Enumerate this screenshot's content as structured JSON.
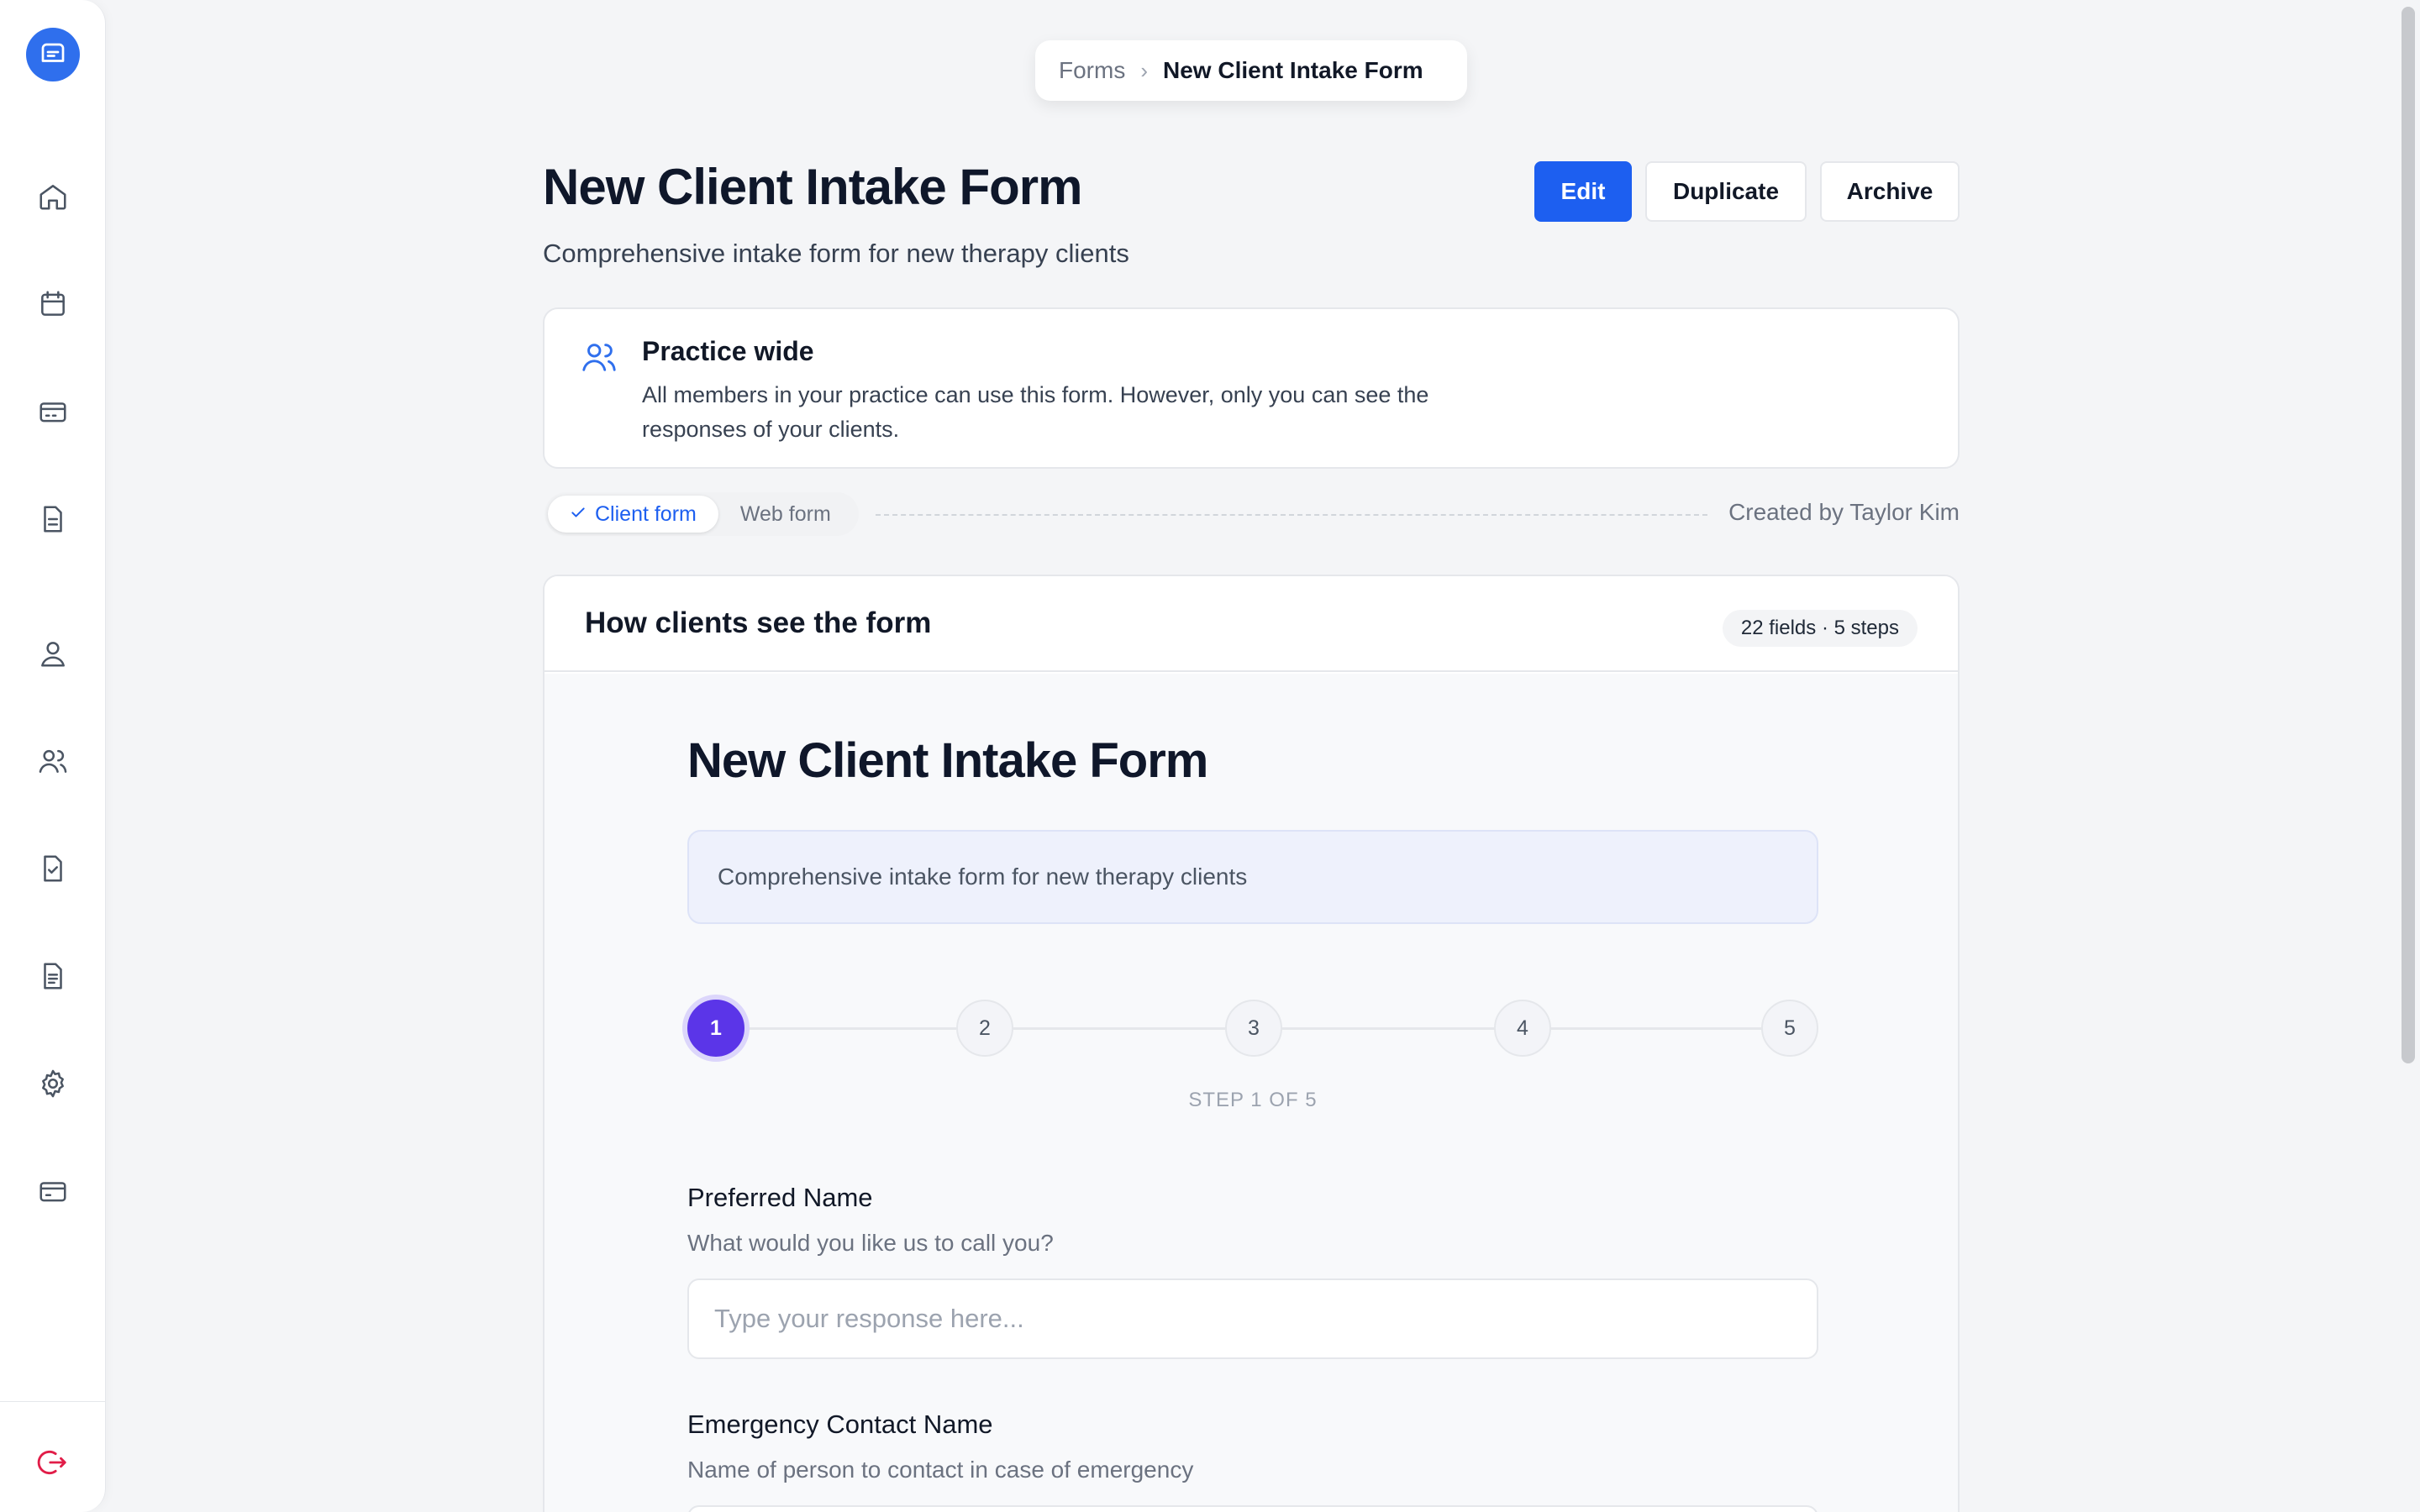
{
  "sidebar": {
    "logo_icon": "chat-logo-icon",
    "items": [
      {
        "icon": "home-icon"
      },
      {
        "icon": "calendar-icon"
      },
      {
        "icon": "billing-card-icon"
      },
      {
        "icon": "document-icon"
      },
      {
        "icon": "user-icon"
      },
      {
        "icon": "users-icon"
      },
      {
        "icon": "file-check-icon"
      },
      {
        "icon": "file-text-icon"
      },
      {
        "icon": "gear-icon"
      },
      {
        "icon": "credit-card-icon"
      }
    ],
    "logout_icon": "logout-icon"
  },
  "breadcrumb": {
    "parent": "Forms",
    "current": "New Client Intake Form"
  },
  "header": {
    "title": "New Client Intake Form",
    "subtitle": "Comprehensive intake form for new therapy clients",
    "edit_label": "Edit",
    "duplicate_label": "Duplicate",
    "archive_label": "Archive"
  },
  "practice": {
    "title": "Practice wide",
    "text": "All members in your practice can use this form. However, only you can see the responses of your clients."
  },
  "form_type": {
    "options": [
      "Client form",
      "Web form"
    ],
    "selected": "Client form"
  },
  "created_by": "Created by Taylor Kim",
  "preview": {
    "title": "How clients see the form",
    "badge": "22 fields · 5 steps",
    "form_title": "New Client Intake Form",
    "form_description": "Comprehensive intake form for new therapy clients",
    "steps": [
      "1",
      "2",
      "3",
      "4",
      "5"
    ],
    "current_step": 1,
    "step_label": "STEP 1 OF 5",
    "fields": [
      {
        "label": "Preferred Name",
        "help": "What would you like us to call you?",
        "placeholder": "Type your response here..."
      },
      {
        "label": "Emergency Contact Name",
        "help": "Name of person to contact in case of emergency",
        "placeholder": ""
      }
    ]
  },
  "colors": {
    "primary": "#1d5ff0",
    "step_active": "#5b35e8",
    "logout": "#e11d48"
  }
}
